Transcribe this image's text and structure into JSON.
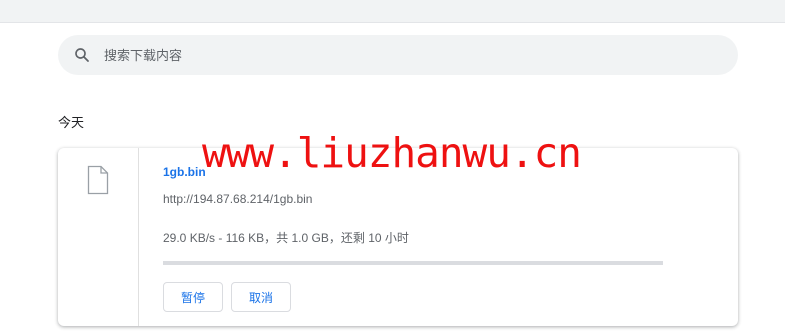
{
  "search": {
    "placeholder": "搜索下载内容",
    "icon": "search-icon"
  },
  "section": {
    "date_label": "今天"
  },
  "download": {
    "file_name": "1gb.bin",
    "url": "http://194.87.68.214/1gb.bin",
    "status": "29.0 KB/s - 116 KB，共 1.0 GB，还剩 10 小时",
    "progress_fraction": 0.000113,
    "icon": "file-icon",
    "buttons": {
      "pause": "暂停",
      "cancel": "取消"
    }
  },
  "watermark": {
    "text": "www.liuzhanwu.cn"
  },
  "colors": {
    "accent": "#1a73e8",
    "watermark": "#ee1111",
    "search_bg": "#f1f3f4",
    "progress_track": "#dadce0"
  }
}
